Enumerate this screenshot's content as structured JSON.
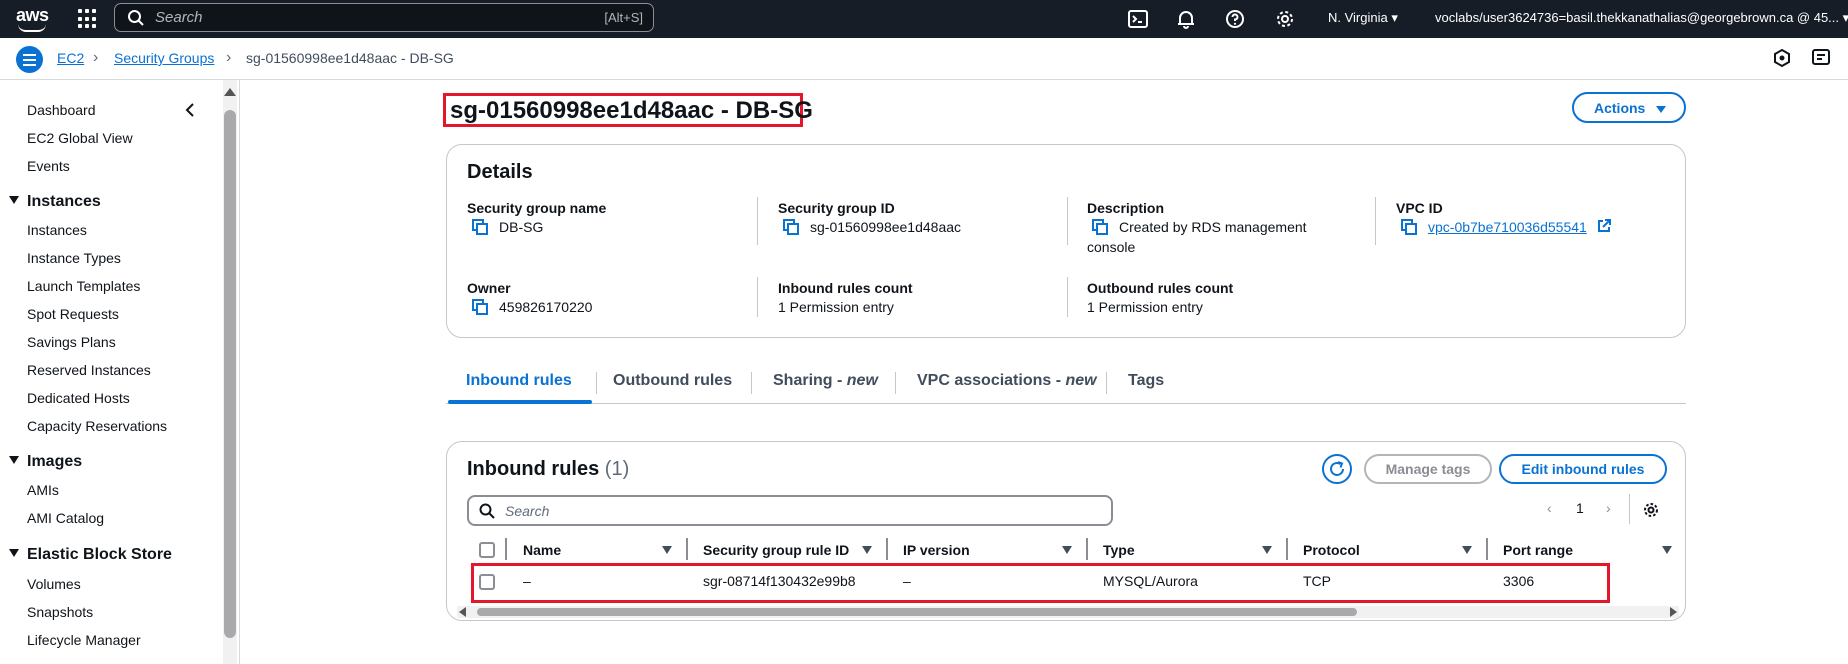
{
  "topbar": {
    "logo": "aws",
    "search_placeholder": "Search",
    "search_shortcut": "[Alt+S]",
    "region": "N. Virginia",
    "account": "voclabs/user3624736=basil.thekkanathalias@georgebrown.ca @ 45...",
    "icons": [
      "grid-icon",
      "cloudshell-icon",
      "bell-icon",
      "help-icon",
      "gear-icon"
    ]
  },
  "breadcrumb": {
    "items": [
      "EC2",
      "Security Groups"
    ],
    "current": "sg-01560998ee1d48aac - DB-SG"
  },
  "sidebar": {
    "top_items": [
      "Dashboard",
      "EC2 Global View",
      "Events"
    ],
    "sections": [
      {
        "title": "Instances",
        "items": [
          "Instances",
          "Instance Types",
          "Launch Templates",
          "Spot Requests",
          "Savings Plans",
          "Reserved Instances",
          "Dedicated Hosts",
          "Capacity Reservations"
        ]
      },
      {
        "title": "Images",
        "items": [
          "AMIs",
          "AMI Catalog"
        ]
      },
      {
        "title": "Elastic Block Store",
        "items": [
          "Volumes",
          "Snapshots",
          "Lifecycle Manager"
        ]
      }
    ]
  },
  "page": {
    "title": "sg-01560998ee1d48aac - DB-SG",
    "actions_label": "Actions"
  },
  "details": {
    "heading": "Details",
    "sg_name_label": "Security group name",
    "sg_name": "DB-SG",
    "sg_id_label": "Security group ID",
    "sg_id": "sg-01560998ee1d48aac",
    "description_label": "Description",
    "description_line1": "Created by RDS management",
    "description_line2": "console",
    "vpc_label": "VPC ID",
    "vpc_id": "vpc-0b7be710036d55541",
    "owner_label": "Owner",
    "owner": "459826170220",
    "inbound_count_label": "Inbound rules count",
    "inbound_count": "1 Permission entry",
    "outbound_count_label": "Outbound rules count",
    "outbound_count": "1 Permission entry"
  },
  "tabs": {
    "inbound": "Inbound rules",
    "outbound": "Outbound rules",
    "sharing": "Sharing",
    "sharing_suffix": "new",
    "vpc_assoc": "VPC associations",
    "vpc_assoc_suffix": "new",
    "tags": "Tags",
    "dash": " - "
  },
  "inbound_table": {
    "heading": "Inbound rules",
    "count": "(1)",
    "manage_tags": "Manage tags",
    "edit_rules": "Edit inbound rules",
    "search_placeholder": "Search",
    "page": "1",
    "columns": [
      "Name",
      "Security group rule ID",
      "IP version",
      "Type",
      "Protocol",
      "Port range"
    ],
    "rows": [
      {
        "name": "–",
        "rule_id": "sgr-08714f130432e99b8",
        "ip_version": "–",
        "type": "MYSQL/Aurora",
        "protocol": "TCP",
        "port_range": "3306"
      }
    ]
  },
  "colors": {
    "accent": "#0972d3",
    "topbar": "#161d26",
    "highlight": "#e3162b"
  }
}
